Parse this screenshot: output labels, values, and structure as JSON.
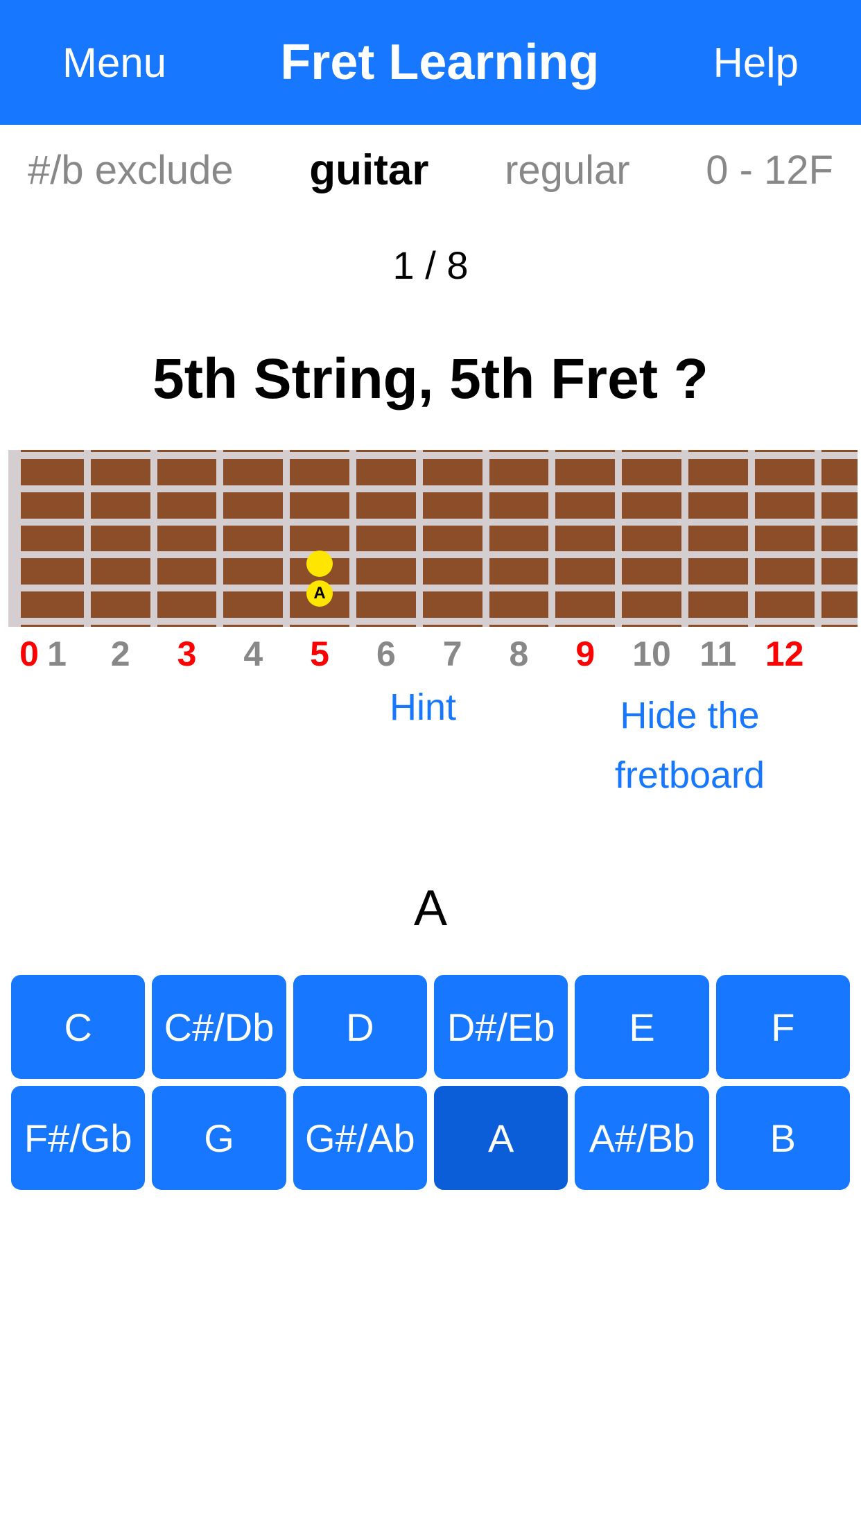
{
  "header": {
    "menu": "Menu",
    "title": "Fret Learning",
    "help": "Help"
  },
  "settings": {
    "mode": "#/b exclude",
    "instrument": "guitar",
    "tuning": "regular",
    "range": "0 - 12F"
  },
  "progress": "1 / 8",
  "question": "5th String, 5th Fret ?",
  "fretboard": {
    "strings": 6,
    "frets": 12,
    "highlight_frets": [
      0,
      3,
      5,
      9,
      12
    ],
    "marker": {
      "string": 5,
      "fret": 5,
      "note": "A"
    }
  },
  "fret_numbers": [
    "0",
    "1",
    "2",
    "3",
    "4",
    "5",
    "6",
    "7",
    "8",
    "9",
    "10",
    "11",
    "12"
  ],
  "links": {
    "hint": "Hint",
    "hide": "Hide the fretboard"
  },
  "answer": "A",
  "notes": [
    "C",
    "C#/Db",
    "D",
    "D#/Eb",
    "E",
    "F",
    "F#/Gb",
    "G",
    "G#/Ab",
    "A",
    "A#/Bb",
    "B"
  ],
  "selected_note_index": 9
}
